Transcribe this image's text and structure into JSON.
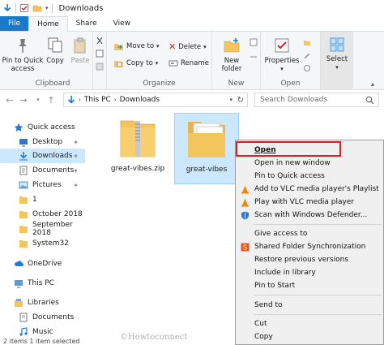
{
  "window": {
    "title": "Downloads"
  },
  "ribbon": {
    "tabs": [
      "File",
      "Home",
      "Share",
      "View"
    ],
    "clipboard": {
      "label": "Clipboard",
      "pin": "Pin to Quick",
      "pin2": "access",
      "copy": "Copy",
      "paste": "Paste"
    },
    "organize": {
      "label": "Organize",
      "move_to": "Move to",
      "copy_to": "Copy to",
      "delete": "Delete",
      "rename": "Rename"
    },
    "new": {
      "label": "New",
      "new_folder": "New",
      "new_folder2": "folder"
    },
    "open": {
      "label": "Open",
      "properties": "Properties"
    },
    "select": {
      "select": "Select"
    }
  },
  "address": {
    "this_pc": "This PC",
    "downloads": "Downloads",
    "search_placeholder": "Search Downloads"
  },
  "nav": {
    "quick_access": "Quick access",
    "desktop": "Desktop",
    "downloads": "Downloads",
    "documents": "Documents",
    "pictures": "Pictures",
    "f1": "1",
    "oct": "October 2018",
    "sep": "September 2018",
    "sys32": "System32",
    "onedrive": "OneDrive",
    "thispc": "This PC",
    "libraries": "Libraries",
    "lib_documents": "Documents",
    "lib_music": "Music"
  },
  "files": [
    {
      "name": "great-vibes.zip"
    },
    {
      "name": "great-vibes"
    }
  ],
  "status": {
    "text": "2 items   1 item selected"
  },
  "watermark": "©Howtoconnect",
  "menu": {
    "open": "Open",
    "open_new_window": "Open in new window",
    "pin_quick": "Pin to Quick access",
    "vlc_playlist": "Add to VLC media player's Playlist",
    "vlc_play": "Play with VLC media player",
    "defender": "Scan with Windows Defender...",
    "give_access": "Give access to",
    "shared_sync": "Shared Folder Synchronization",
    "restore": "Restore previous versions",
    "include_library": "Include in library",
    "pin_start": "Pin to Start",
    "send_to": "Send to",
    "cut": "Cut",
    "copy": "Copy"
  },
  "colors": {
    "accent": "#1979ca",
    "selection": "#cce8ff",
    "highlight": "#d6212a",
    "folder": "#f4c45d"
  }
}
